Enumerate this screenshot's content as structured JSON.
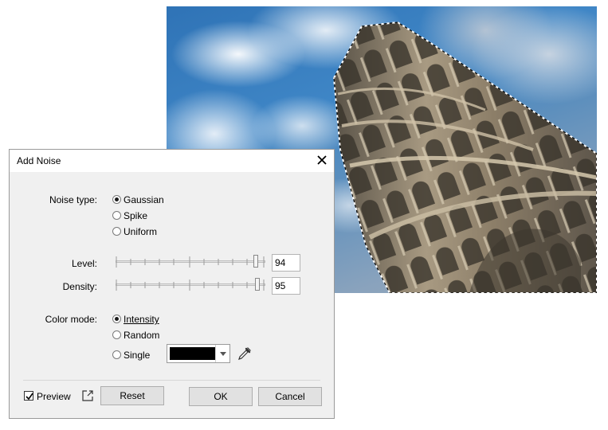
{
  "dialog": {
    "title": "Add Noise",
    "noise_type": {
      "label": "Noise type:",
      "options": [
        "Gaussian",
        "Spike",
        "Uniform"
      ],
      "selected": "Gaussian"
    },
    "level": {
      "label": "Level:",
      "value": "94"
    },
    "density": {
      "label": "Density:",
      "value": "95"
    },
    "color_mode": {
      "label": "Color mode:",
      "options": [
        "Intensity",
        "Random",
        "Single"
      ],
      "selected": "Intensity",
      "single_color": "#000000"
    },
    "preview": {
      "label": "Preview",
      "checked": true
    },
    "buttons": {
      "reset": "Reset",
      "ok": "OK",
      "cancel": "Cancel"
    },
    "icons": {
      "close": "close-icon",
      "popout": "popout-icon",
      "eyedropper": "eyedropper-icon"
    }
  }
}
